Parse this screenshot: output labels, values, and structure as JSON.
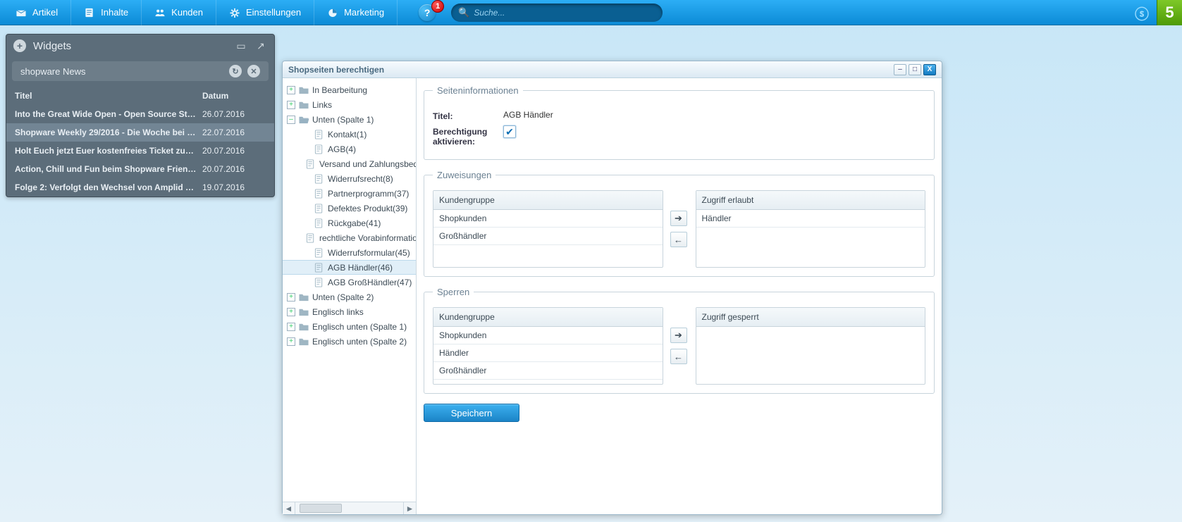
{
  "topmenu": {
    "items": [
      {
        "label": "Artikel",
        "icon": "tray"
      },
      {
        "label": "Inhalte",
        "icon": "page"
      },
      {
        "label": "Kunden",
        "icon": "people"
      },
      {
        "label": "Einstellungen",
        "icon": "gear"
      },
      {
        "label": "Marketing",
        "icon": "pie"
      }
    ],
    "help_badge": "1",
    "search_placeholder": "Suche...",
    "brand_glyph": "ⓢ",
    "five": "5"
  },
  "widgets": {
    "title": "Widgets",
    "pill_title": "shopware News",
    "columns": {
      "title": "Titel",
      "date": "Datum"
    },
    "rows": [
      {
        "title": "Into the Great Wide Open - Open Source Str…",
        "date": "26.07.2016"
      },
      {
        "title": "Shopware Weekly 29/2016 - Die Woche bei …",
        "date": "22.07.2016",
        "sel": true
      },
      {
        "title": "Holt Euch jetzt Euer kostenfreies Ticket zu…",
        "date": "20.07.2016"
      },
      {
        "title": "Action, Chill und Fun beim Shopware Frien…",
        "date": "20.07.2016"
      },
      {
        "title": "Folge 2: Verfolgt den Wechsel von Amplid …",
        "date": "19.07.2016"
      }
    ]
  },
  "window": {
    "title": "Shopseiten berechtigen",
    "btn_min": "–",
    "btn_max": "□",
    "btn_close": "X",
    "tree": {
      "nodes": [
        {
          "label": "In Bearbeitung",
          "type": "folder",
          "lvl": 0,
          "tw": "+"
        },
        {
          "label": "Links",
          "type": "folder",
          "lvl": 0,
          "tw": "+"
        },
        {
          "label": "Unten (Spalte 1)",
          "type": "folder-open",
          "lvl": 0,
          "tw": "–"
        },
        {
          "label": "Kontakt(1)",
          "type": "file",
          "lvl": 1
        },
        {
          "label": "AGB(4)",
          "type": "file",
          "lvl": 1
        },
        {
          "label": "Versand und Zahlungsbedingu",
          "type": "file",
          "lvl": 1
        },
        {
          "label": "Widerrufsrecht(8)",
          "type": "file",
          "lvl": 1
        },
        {
          "label": "Partnerprogramm(37)",
          "type": "file",
          "lvl": 1
        },
        {
          "label": "Defektes Produkt(39)",
          "type": "file",
          "lvl": 1
        },
        {
          "label": "Rückgabe(41)",
          "type": "file",
          "lvl": 1
        },
        {
          "label": "rechtliche Vorabinformationen(",
          "type": "file",
          "lvl": 1
        },
        {
          "label": "Widerrufsformular(45)",
          "type": "file",
          "lvl": 1
        },
        {
          "label": "AGB Händler(46)",
          "type": "file",
          "lvl": 1,
          "sel": true
        },
        {
          "label": "AGB GroßHändler(47)",
          "type": "file",
          "lvl": 1
        },
        {
          "label": "Unten (Spalte 2)",
          "type": "folder",
          "lvl": 0,
          "tw": "+"
        },
        {
          "label": "Englisch links",
          "type": "folder",
          "lvl": 0,
          "tw": "+"
        },
        {
          "label": "Englisch unten (Spalte 1)",
          "type": "folder",
          "lvl": 0,
          "tw": "+"
        },
        {
          "label": "Englisch unten (Spalte 2)",
          "type": "folder",
          "lvl": 0,
          "tw": "+"
        }
      ]
    },
    "info": {
      "legend": "Seiteninformationen",
      "title_lbl": "Titel:",
      "title_val": "AGB Händler",
      "perm_lbl": "Berechtigung aktivieren:",
      "perm_checked": true
    },
    "assign": {
      "legend": "Zuweisungen",
      "left_hdr": "Kundengruppe",
      "right_hdr": "Zugriff erlaubt",
      "left": [
        "Shopkunden",
        "Großhändler"
      ],
      "right": [
        "Händler"
      ]
    },
    "block": {
      "legend": "Sperren",
      "left_hdr": "Kundengruppe",
      "right_hdr": "Zugriff gesperrt",
      "left": [
        "Shopkunden",
        "Händler",
        "Großhändler"
      ],
      "right": []
    },
    "save": "Speichern"
  }
}
